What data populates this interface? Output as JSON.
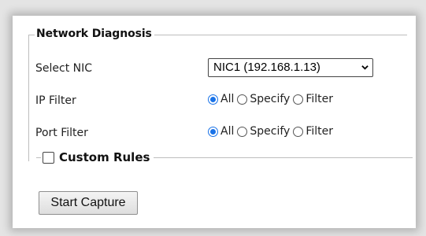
{
  "group": {
    "title": "Network Diagnosis"
  },
  "select_nic": {
    "label": "Select NIC",
    "value": "NIC1 (192.168.1.13)"
  },
  "ip_filter": {
    "label": "IP Filter",
    "options": [
      "All",
      "Specify",
      "Filter"
    ],
    "selected": "All"
  },
  "port_filter": {
    "label": "Port Filter",
    "options": [
      "All",
      "Specify",
      "Filter"
    ],
    "selected": "All"
  },
  "custom_rules": {
    "label": "Custom Rules",
    "checked": false
  },
  "actions": {
    "start_capture": "Start Capture"
  },
  "colors": {
    "accent": "#1a73e8",
    "panel": "#ffffff",
    "border": "#bdbdbd"
  }
}
